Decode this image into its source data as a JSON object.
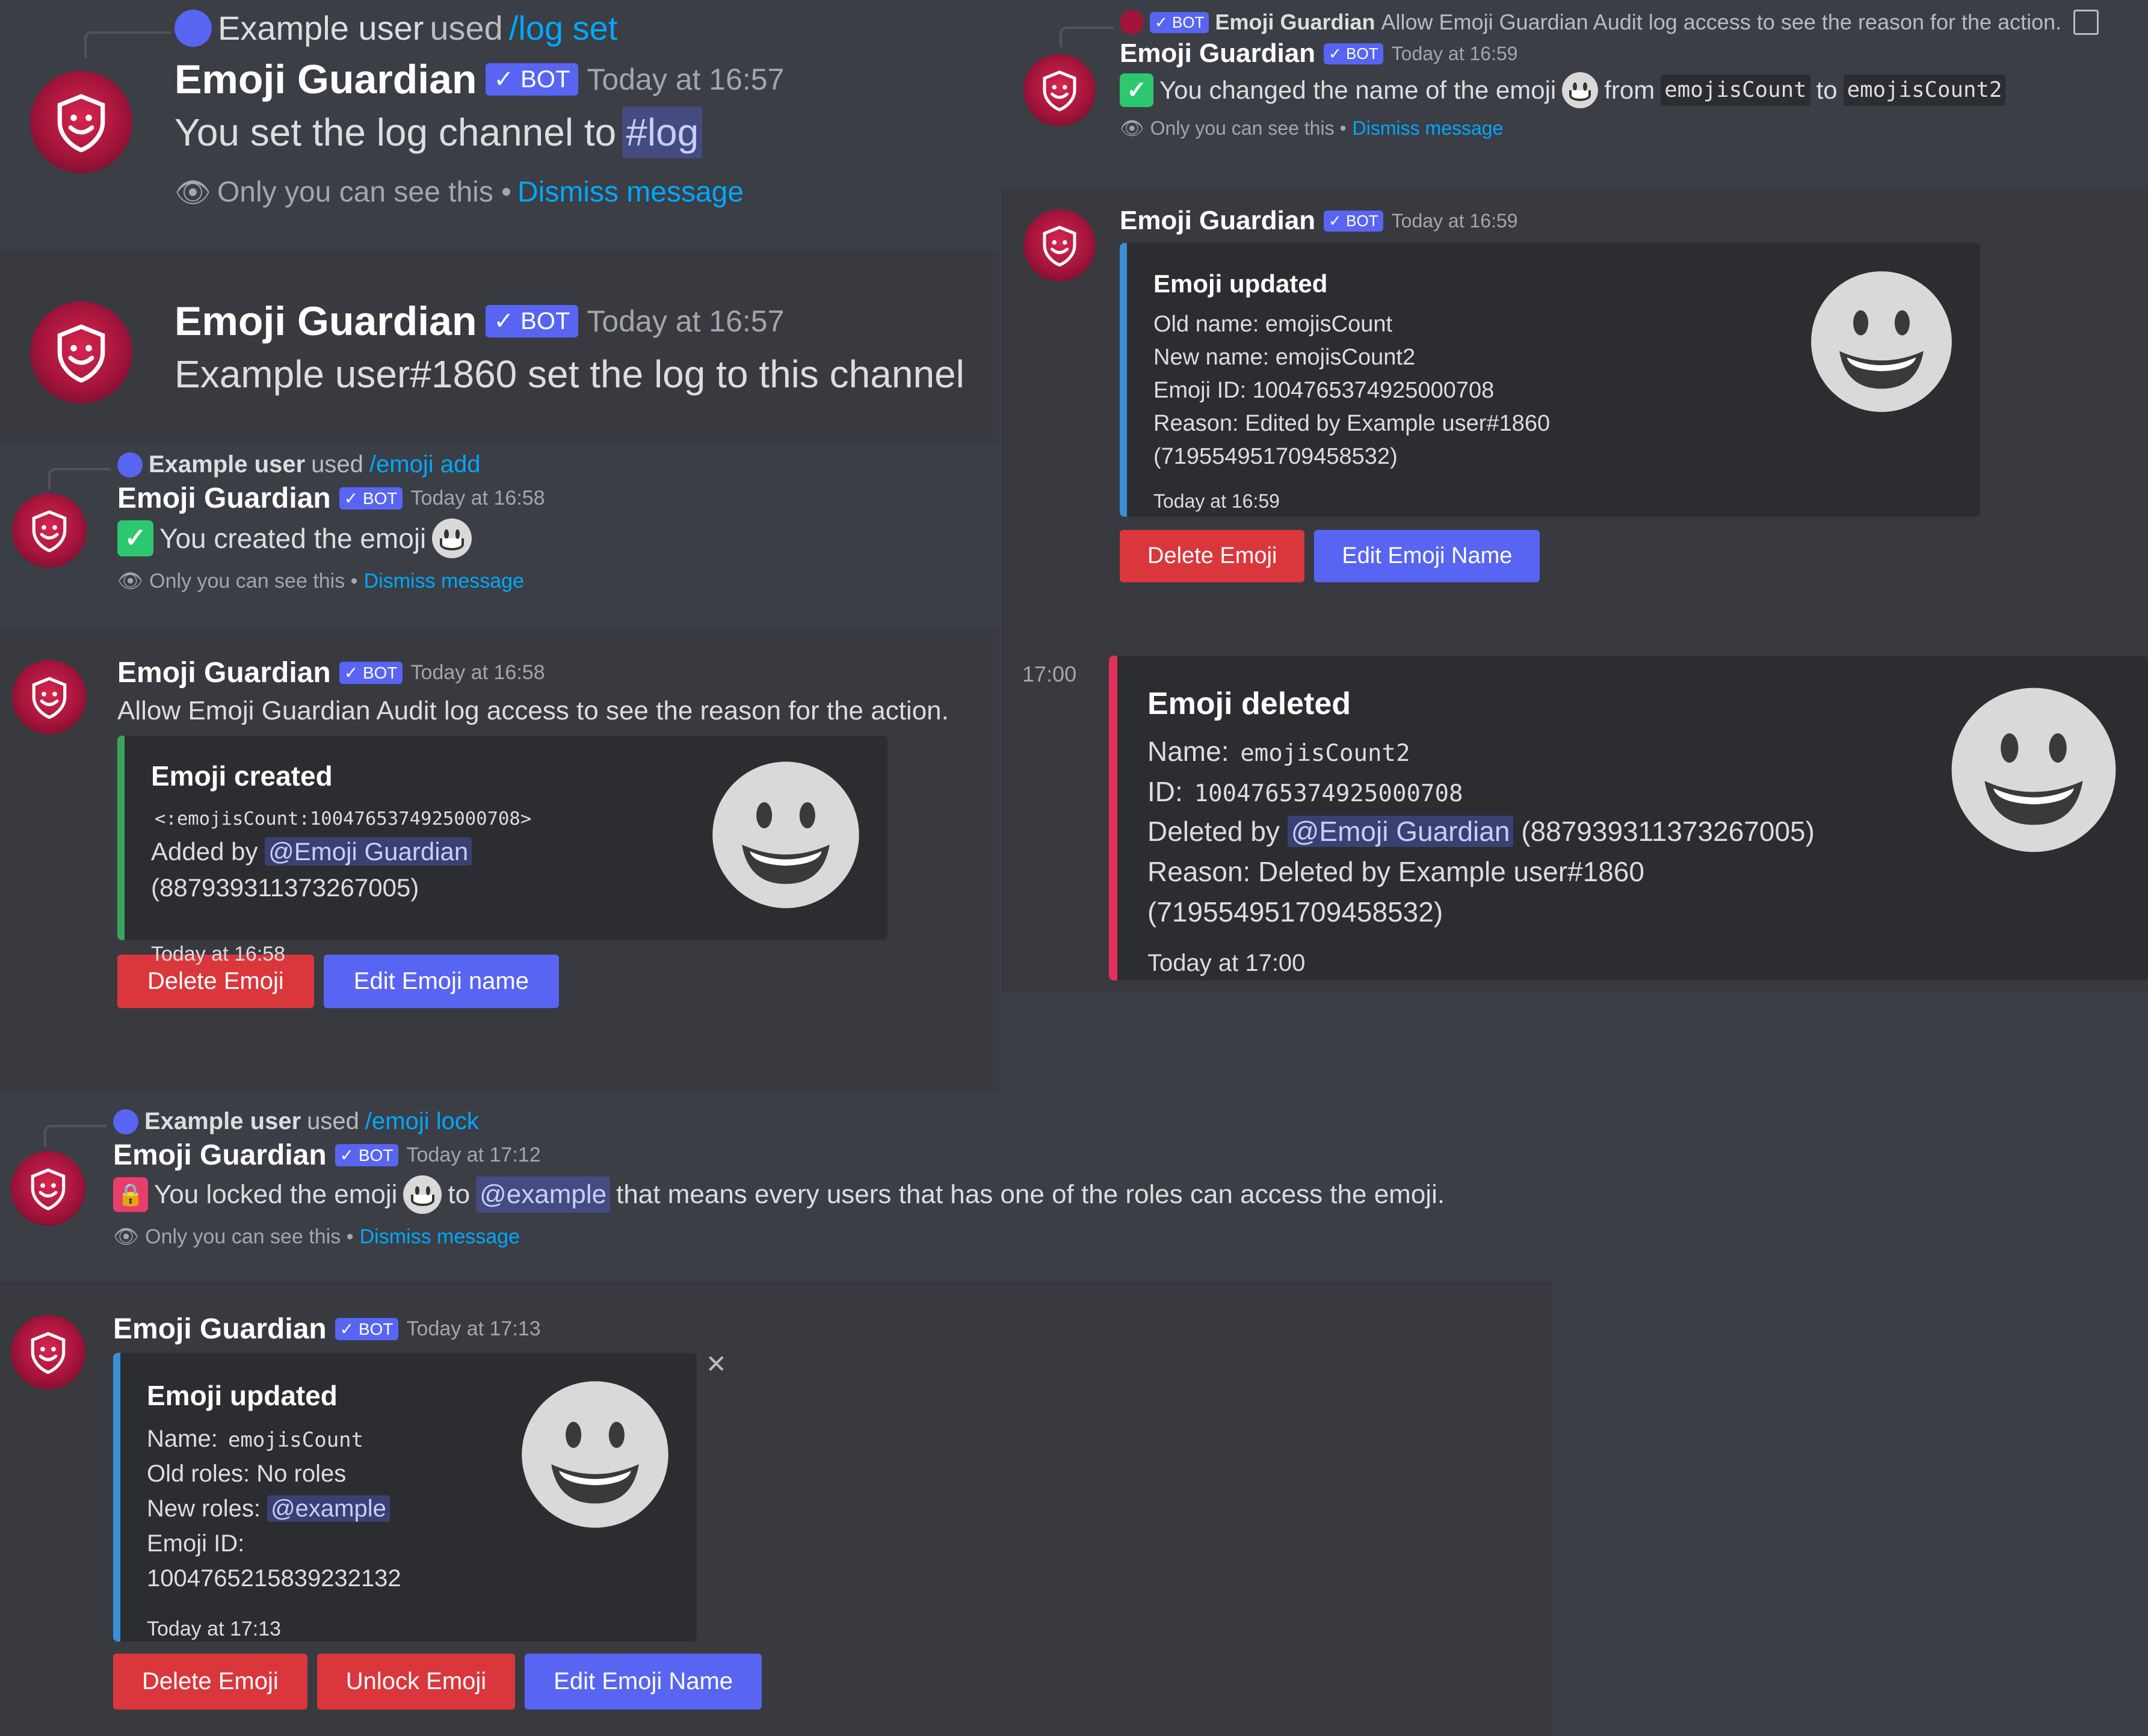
{
  "bot_name": "Emoji Guardian",
  "bot_badge": "✓ BOT",
  "ephemeral": {
    "text": "Only you can see this •",
    "link": "Dismiss message"
  },
  "p1": {
    "ref_user": "Example user",
    "ref_used": "used",
    "ref_cmd": "/log set",
    "time": "Today at 16:57",
    "body_a": "You set the log channel to",
    "channel": "#log"
  },
  "p2": {
    "time": "Today at 16:57",
    "body": "Example user#1860 set the log to this channel"
  },
  "p3": {
    "ref_user": "Example user",
    "ref_used": "used",
    "ref_cmd": "/emoji add",
    "time": "Today at 16:58",
    "body": "You created the emoji"
  },
  "p4": {
    "time": "Today at 16:58",
    "body": "Allow Emoji Guardian Audit log access to see the reason for the action.",
    "embed_title": "Emoji created",
    "code": "<:emojisCount:1004765374925000708>",
    "added_by": "Added by",
    "mention": "@Emoji Guardian",
    "id": "(887939311373267005)",
    "footer": "Today at 16:58",
    "btn_delete": "Delete Emoji",
    "btn_edit": "Edit Emoji name"
  },
  "p5": {
    "ref_user": "Example user",
    "ref_used": "used",
    "ref_cmd": "/emoji lock",
    "time": "Today at 17:12",
    "body_a": "You locked the emoji",
    "body_b": "to",
    "mention": "@example",
    "body_c": "that means every users that has one of the roles can access the emoji."
  },
  "p6": {
    "time": "Today at 17:13",
    "embed_title": "Emoji updated",
    "name_label": "Name:",
    "name_val": "emojisCount",
    "old_roles": "Old roles: No roles",
    "new_roles_label": "New roles:",
    "new_roles_val": "@example",
    "emoji_id": "Emoji ID: 1004765215839232132",
    "footer": "Today at 17:13",
    "btn_delete": "Delete Emoji",
    "btn_unlock": "Unlock Emoji",
    "btn_edit": "Edit Emoji Name"
  },
  "r1": {
    "ref_name": "Emoji Guardian",
    "ref_text": "Allow Emoji Guardian Audit log access to see the reason for the action.",
    "time": "Today at 16:59",
    "body_a": "You changed the name of the emoji",
    "body_b": "from",
    "from": "emojisCount",
    "body_c": "to",
    "to": "emojisCount2"
  },
  "r2": {
    "time": "Today at 16:59",
    "embed_title": "Emoji updated",
    "lines": [
      "Old name: emojisCount",
      "New name: emojisCount2",
      "Emoji ID: 1004765374925000708",
      "Reason: Edited by Example user#1860 (719554951709458532)"
    ],
    "footer": "Today at 16:59",
    "btn_delete": "Delete Emoji",
    "btn_edit": "Edit Emoji Name"
  },
  "r3": {
    "time_gutter": "17:00",
    "embed_title": "Emoji deleted",
    "name_label": "Name:",
    "name_val": "emojisCount2",
    "id_label": "ID:",
    "id_val": "1004765374925000708",
    "deleted_by": "Deleted by",
    "mention": "@Emoji Guardian",
    "mention_id": "(887939311373267005)",
    "reason": "Reason: Deleted by Example user#1860 (719554951709458532)",
    "footer": "Today at 17:00"
  },
  "colors": {
    "bg": "#3b3e45",
    "embed_bg": "#2b2d31",
    "green_bar": "#3ba55d",
    "blue_bar": "#3a8fd6",
    "red_bar": "#e3305b",
    "blurple": "#5865f2",
    "danger": "#da373c",
    "link": "#00a8fc"
  }
}
